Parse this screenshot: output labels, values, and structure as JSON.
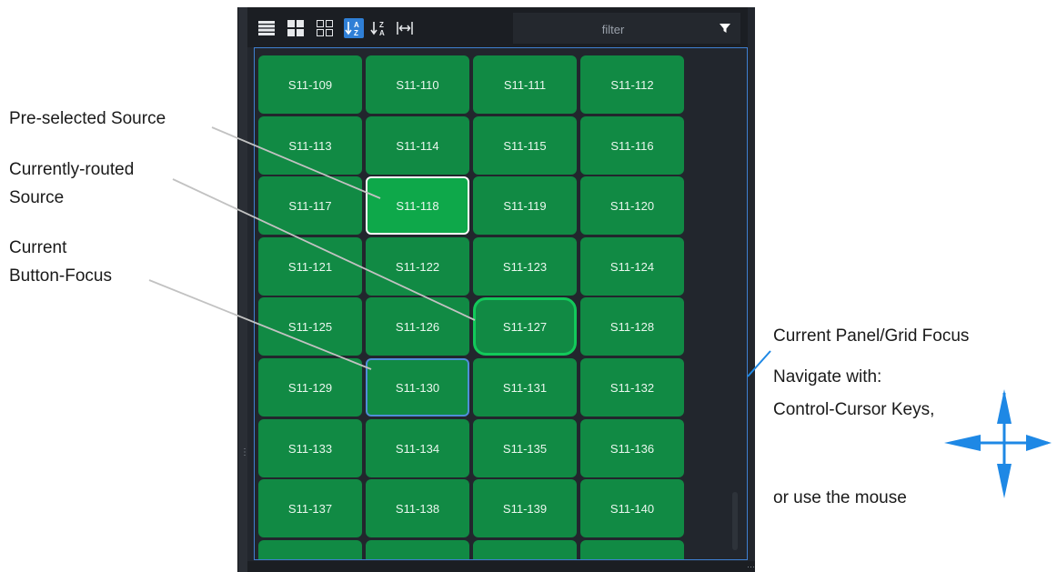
{
  "toolbar": {
    "buttons": [
      {
        "icon": "list-view-icon"
      },
      {
        "icon": "large-grid-view-icon"
      },
      {
        "icon": "small-grid-view-icon"
      },
      {
        "icon": "sort-a-z-icon",
        "active": true
      },
      {
        "icon": "sort-z-a-icon"
      },
      {
        "icon": "fit-width-icon"
      }
    ],
    "filter_placeholder": "filter",
    "filter_icon": "filter-funnel-icon"
  },
  "sources": [
    [
      "S11-109",
      "S11-110",
      "S11-111",
      "S11-112"
    ],
    [
      "S11-113",
      "S11-114",
      "S11-115",
      "S11-116"
    ],
    [
      "S11-117",
      "S11-118",
      "S11-119",
      "S11-120"
    ],
    [
      "S11-121",
      "S11-122",
      "S11-123",
      "S11-124"
    ],
    [
      "S11-125",
      "S11-126",
      "S11-127",
      "S11-128"
    ],
    [
      "S11-129",
      "S11-130",
      "S11-131",
      "S11-132"
    ],
    [
      "S11-133",
      "S11-134",
      "S11-135",
      "S11-136"
    ],
    [
      "S11-137",
      "S11-138",
      "S11-139",
      "S11-140"
    ]
  ],
  "states": {
    "preselected": "S11-118",
    "routed": "S11-127",
    "focused": "S11-130"
  },
  "annotations": {
    "preselected": "Pre-selected Source",
    "routed_line1": "Currently-routed",
    "routed_line2": "Source",
    "focus_line1": "Current",
    "focus_line2": "Button-Focus",
    "panel_focus": "Current Panel/Grid Focus",
    "navigate": "Navigate with:",
    "keys": "Control-Cursor Keys,",
    "mouse": "or use the mouse"
  },
  "colors": {
    "button_green": "#118a44",
    "preselected_green": "#0ea84a",
    "routed_border": "#12c95a",
    "focus_blue": "#4e8fd8",
    "arrow_blue": "#1e88e5"
  }
}
